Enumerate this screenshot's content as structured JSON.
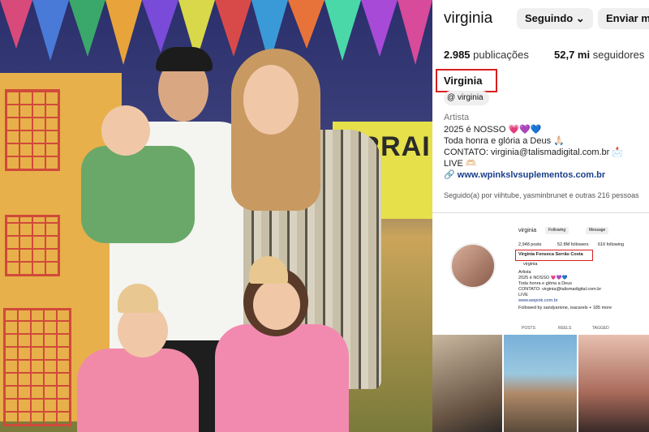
{
  "profile": {
    "username": "virginia",
    "following_button": "Seguindo",
    "message_button": "Enviar mensagem",
    "posts_count": "2.985",
    "posts_label": "publicações",
    "followers_count": "52,7 mi",
    "followers_label": "seguidores",
    "display_name": "Virginia",
    "threads_handle": "virginia",
    "category": "Artista",
    "bio_line1": "2025 é NOSSO 💗💜💙",
    "bio_line2": "Toda honra e glória a Deus 🙏🏻",
    "bio_line3": "CONTATO: virginia@talismadigital.com.br 📩",
    "bio_line4": "LIVE 🫶🏻",
    "link": "www.wpinkslvsuplementos.com.br",
    "followed_by": "Seguido(a) por viihtube, yasminbrunet e outras 216 pessoas"
  },
  "mini_profile": {
    "username": "virginia",
    "following_button": "Following",
    "message_button": "Message",
    "posts": "2,948 posts",
    "followers": "52.8M followers",
    "following": "616 following",
    "display_name": "Virginia Fonseca Serrão Costa",
    "threads_handle": "virginia",
    "category": "Artista",
    "bio_line1": "2025 é NOSSO 💗💜💙",
    "bio_line2": "Toda honra e glória a Deus",
    "bio_line3": "CONTATO: virginia@talismadigital.com.br",
    "bio_line4": "LIVE",
    "link": "www.wepink.com.br",
    "followed_by": "Followed by sandyarione, isacarels + 185 more"
  },
  "tabs": {
    "posts": "POSTS",
    "reels": "REELS",
    "tagged": "TAGGED"
  },
  "photo": {
    "banner_text": "ARRAI"
  },
  "colors": {
    "highlight_box": "#d62020",
    "verified": "#0095f6",
    "link": "#1a3e8c"
  }
}
